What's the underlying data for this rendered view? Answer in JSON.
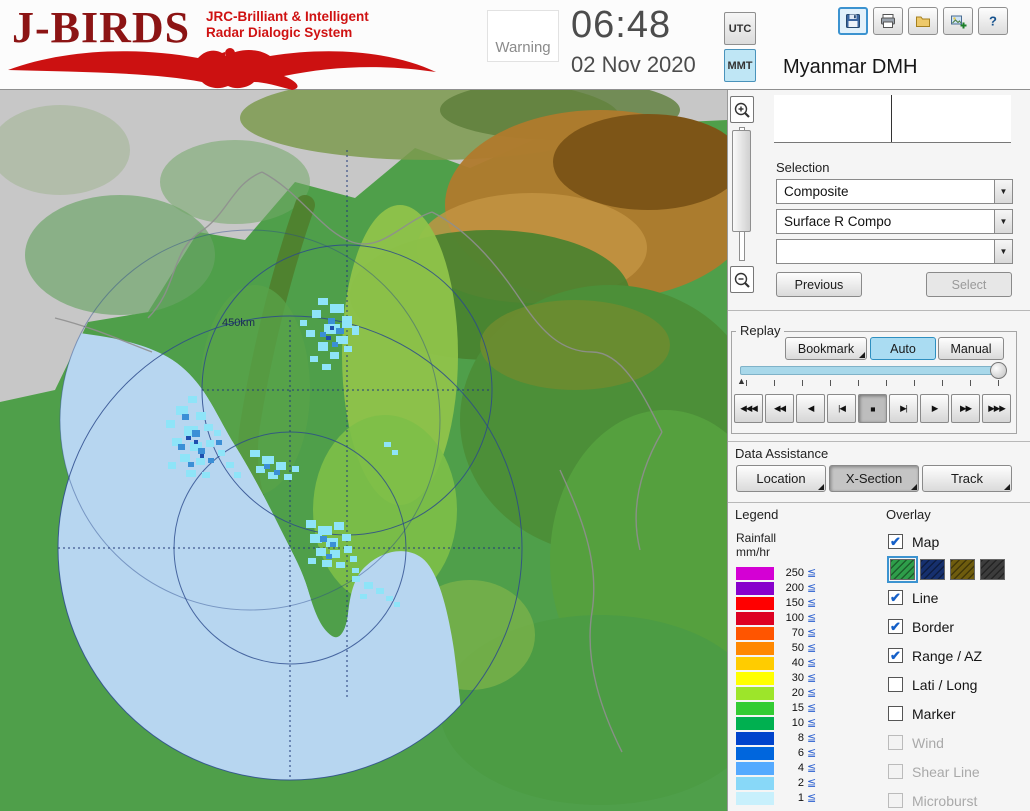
{
  "header": {
    "logo": {
      "title": "J-BIRDS",
      "subtitle1": "JRC-Brilliant & Intelligent",
      "subtitle2": "Radar  Dialogic  System"
    },
    "warning_label": "Warning",
    "clock": {
      "time": "06:48",
      "date": "02 Nov 2020"
    },
    "timezone": {
      "utc_label": "UTC",
      "mmt_label": "MMT",
      "selected": "MMT"
    },
    "toolbar_icons": [
      "save-icon",
      "print-icon",
      "open-folder-icon",
      "export-image-icon",
      "help-icon"
    ],
    "station_title": "Myanmar DMH"
  },
  "map": {
    "range_label": "450km"
  },
  "selection": {
    "label": "Selection",
    "dropdown1": "Composite",
    "dropdown2": "Surface R Compo",
    "dropdown3": "",
    "previous_label": "Previous",
    "select_label": "Select"
  },
  "replay": {
    "label": "Replay",
    "bookmark_label": "Bookmark",
    "auto_label": "Auto",
    "manual_label": "Manual",
    "selected_mode": "Auto",
    "playback": [
      {
        "name": "jump-start-button",
        "glyph": "◀◀◀",
        "pressed": false
      },
      {
        "name": "fast-rewind-button",
        "glyph": "◀◀",
        "pressed": false
      },
      {
        "name": "play-reverse-button",
        "glyph": "◀",
        "pressed": false
      },
      {
        "name": "step-back-button",
        "glyph": "|◀",
        "pressed": false
      },
      {
        "name": "stop-button",
        "glyph": "■",
        "pressed": true
      },
      {
        "name": "step-forward-button",
        "glyph": "▶|",
        "pressed": false
      },
      {
        "name": "play-button",
        "glyph": "▶",
        "pressed": false
      },
      {
        "name": "fast-forward-button",
        "glyph": "▶▶",
        "pressed": false
      },
      {
        "name": "jump-end-button",
        "glyph": "▶▶▶",
        "pressed": false
      }
    ]
  },
  "data_assistance": {
    "label": "Data Assistance",
    "buttons": [
      {
        "label": "Location",
        "pressed": false
      },
      {
        "label": "X-Section",
        "pressed": true
      },
      {
        "label": "Track",
        "pressed": false
      }
    ]
  },
  "legend": {
    "label": "Legend",
    "unit_line1": "Rainfall",
    "unit_line2": "mm/hr",
    "le_symbol": "≦",
    "entries": [
      {
        "value": "250",
        "color": "#d400d4"
      },
      {
        "value": "200",
        "color": "#8800cc"
      },
      {
        "value": "150",
        "color": "#ff0000"
      },
      {
        "value": "100",
        "color": "#dd0022"
      },
      {
        "value": "70",
        "color": "#ff5500"
      },
      {
        "value": "50",
        "color": "#ff8800"
      },
      {
        "value": "40",
        "color": "#ffcc00"
      },
      {
        "value": "30",
        "color": "#ffff00"
      },
      {
        "value": "20",
        "color": "#9de52a"
      },
      {
        "value": "15",
        "color": "#33cc33"
      },
      {
        "value": "10",
        "color": "#00b050"
      },
      {
        "value": "8",
        "color": "#0044cc"
      },
      {
        "value": "6",
        "color": "#0066dd"
      },
      {
        "value": "4",
        "color": "#55aaff"
      },
      {
        "value": "2",
        "color": "#88d8f8"
      },
      {
        "value": "1",
        "color": "#c8f0fc"
      }
    ]
  },
  "overlay": {
    "label": "Overlay",
    "items": [
      {
        "label": "Map",
        "checked": true,
        "enabled": true
      },
      {
        "label": "Line",
        "checked": true,
        "enabled": true
      },
      {
        "label": "Border",
        "checked": true,
        "enabled": true
      },
      {
        "label": "Range / AZ",
        "checked": true,
        "enabled": true
      },
      {
        "label": "Lati / Long",
        "checked": false,
        "enabled": true
      },
      {
        "label": "Marker",
        "checked": false,
        "enabled": true
      },
      {
        "label": "Wind",
        "checked": false,
        "enabled": false
      },
      {
        "label": "Shear Line",
        "checked": false,
        "enabled": false
      },
      {
        "label": "Microburst",
        "checked": false,
        "enabled": false
      }
    ],
    "map_swatches": [
      {
        "name": "map-color-green-swatch",
        "color": "#2e9e4a",
        "selected": true
      },
      {
        "name": "map-color-navy-swatch",
        "color": "#16306e",
        "selected": false
      },
      {
        "name": "map-color-olive-swatch",
        "color": "#6e5c0e",
        "selected": false
      },
      {
        "name": "map-color-gray-swatch",
        "color": "#3c3c3c",
        "selected": false
      }
    ]
  }
}
